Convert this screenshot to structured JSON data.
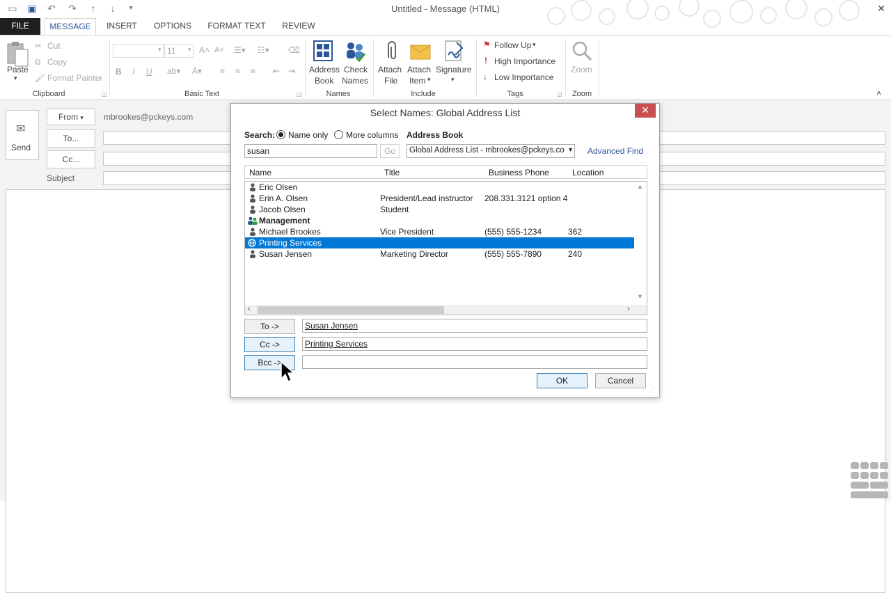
{
  "window": {
    "title": "Untitled - Message (HTML)",
    "close_glyph": "✕"
  },
  "tabs": [
    "FILE",
    "MESSAGE",
    "INSERT",
    "OPTIONS",
    "FORMAT TEXT",
    "REVIEW"
  ],
  "ribbon": {
    "clipboard": {
      "paste": "Paste",
      "cut": "Cut",
      "copy": "Copy",
      "format_painter": "Format Painter",
      "label": "Clipboard"
    },
    "basic_text": {
      "font_size": "11",
      "label": "Basic Text"
    },
    "names": {
      "address_book_1": "Address",
      "address_book_2": "Book",
      "check_names_1": "Check",
      "check_names_2": "Names",
      "label": "Names"
    },
    "include": {
      "attach_file_1": "Attach",
      "attach_file_2": "File",
      "attach_item_1": "Attach",
      "attach_item_2": "Item",
      "signature": "Signature",
      "label": "Include"
    },
    "tags": {
      "follow_up": "Follow Up",
      "high_importance": "High Importance",
      "low_importance": "Low Importance",
      "label": "Tags"
    },
    "zoom": {
      "zoom": "Zoom",
      "label": "Zoom"
    }
  },
  "message": {
    "send": "Send",
    "from_label": "From",
    "from_value": "mbrookes@pckeys.com",
    "to_label": "To...",
    "cc_label": "Cc...",
    "subject_label": "Subject"
  },
  "dialog": {
    "title": "Select Names: Global Address List",
    "search_label": "Search:",
    "name_only": "Name only",
    "more_columns": "More columns",
    "address_book_label": "Address Book",
    "search_value": "susan",
    "go": "Go",
    "address_book_value": "Global Address List - mbrookes@pckeys.co",
    "advanced_find": "Advanced Find",
    "columns": [
      "Name",
      "Title",
      "Business Phone",
      "Location"
    ],
    "rows": [
      {
        "name": "Eric Olsen",
        "title": "",
        "phone": "",
        "location": "",
        "type": "person",
        "bold": false,
        "selected": false
      },
      {
        "name": "Erin A. Olsen",
        "title": "President/Lead instructor",
        "phone": "208.331.3121 option 4",
        "location": "",
        "type": "person",
        "bold": false,
        "selected": false
      },
      {
        "name": "Jacob Olsen",
        "title": "Student",
        "phone": "",
        "location": "",
        "type": "person",
        "bold": false,
        "selected": false
      },
      {
        "name": "Management",
        "title": "",
        "phone": "",
        "location": "",
        "type": "group",
        "bold": true,
        "selected": false
      },
      {
        "name": "Michael Brookes",
        "title": "Vice President",
        "phone": "(555) 555-1234",
        "location": "362",
        "type": "person",
        "bold": false,
        "selected": false
      },
      {
        "name": "Printing Services",
        "title": "",
        "phone": "",
        "location": "",
        "type": "globe",
        "bold": false,
        "selected": true
      },
      {
        "name": "Susan Jensen",
        "title": "Marketing Director",
        "phone": "(555) 555-7890",
        "location": "240",
        "type": "person",
        "bold": false,
        "selected": false
      }
    ],
    "to_button": "To ->",
    "cc_button": "Cc ->",
    "bcc_button": "Bcc ->",
    "to_value": "Susan Jensen",
    "cc_value": "Printing Services",
    "bcc_value": "",
    "ok": "OK",
    "cancel": "Cancel"
  },
  "colors": {
    "accent": "#2b579a",
    "selection": "#0078d7",
    "close_red": "#c75050",
    "flag_red": "#d13438"
  }
}
